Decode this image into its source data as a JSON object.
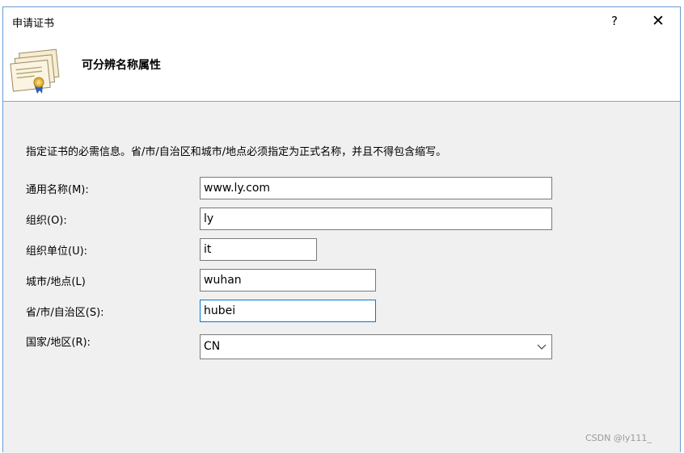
{
  "window": {
    "title": "申请证书",
    "help_label": "?",
    "close_label": "✕"
  },
  "header": {
    "title": "可分辨名称属性",
    "icon": "certificate-icon"
  },
  "instruction": "指定证书的必需信息。省/市/自治区和城市/地点必须指定为正式名称，并且不得包含缩写。",
  "fields": {
    "common_name": {
      "label": "通用名称(M):",
      "value": "www.ly.com"
    },
    "organization": {
      "label": "组织(O):",
      "value": "ly"
    },
    "org_unit": {
      "label": "组织单位(U):",
      "value": "it"
    },
    "city": {
      "label": "城市/地点(L)",
      "value": "wuhan"
    },
    "state": {
      "label": "省/市/自治区(S):",
      "value": "hubei"
    },
    "country": {
      "label": "国家/地区(R):",
      "value": "CN",
      "icon": "chevron-down-icon"
    }
  },
  "watermark": "CSDN @ly111_"
}
